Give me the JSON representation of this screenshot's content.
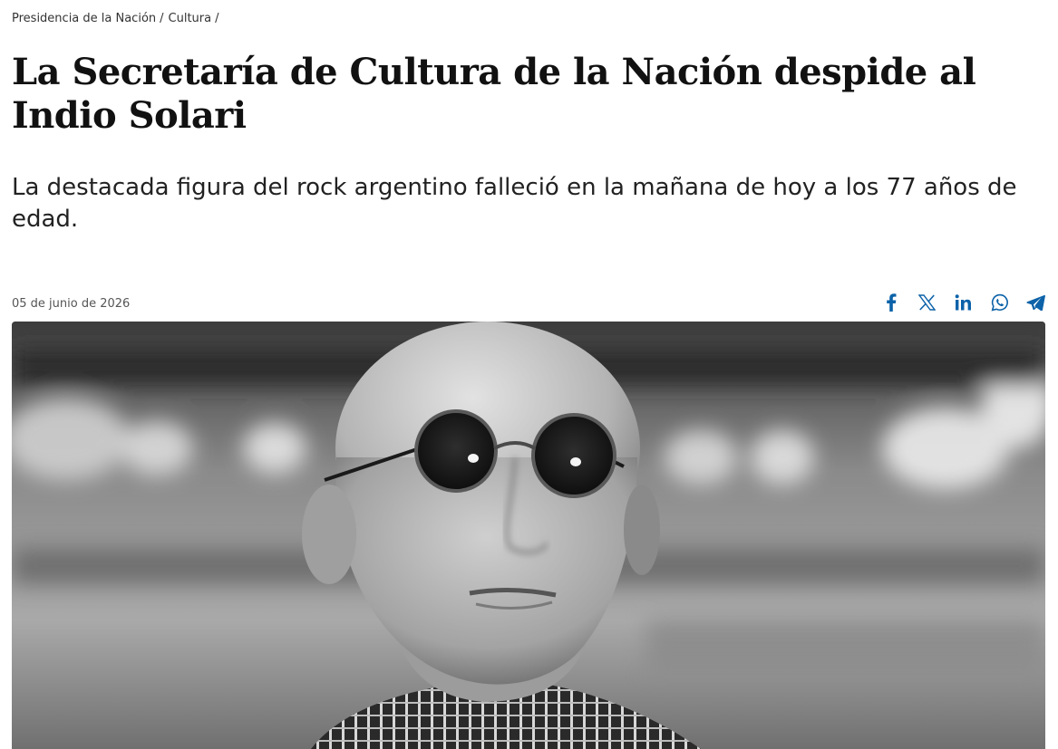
{
  "breadcrumb": {
    "items": [
      "Presidencia de la Nación",
      "Cultura"
    ],
    "separator": "/"
  },
  "article": {
    "title": "La Secretaría de Cultura de la Nación despide al Indio Solari",
    "subtitle": "La destacada figura del rock argentino falleció en la mañana de hoy a los 77 años de edad.",
    "date": "05 de junio de 2026"
  },
  "share": {
    "icons": [
      "facebook-icon",
      "x-icon",
      "linkedin-icon",
      "whatsapp-icon",
      "telegram-icon"
    ],
    "color": "#0c62a8"
  },
  "hero_image": {
    "description_icon": "portrait-photo",
    "style": "black-and-white"
  },
  "colors": {
    "text": "#111111",
    "muted": "#555555",
    "accent": "#0c62a8"
  }
}
